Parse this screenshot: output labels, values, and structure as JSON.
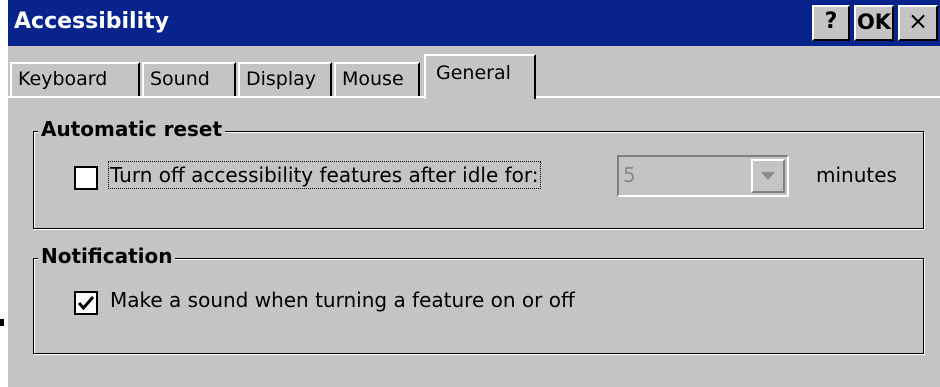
{
  "window": {
    "title": "Accessibility",
    "help_label": "?",
    "ok_label": "OK",
    "close_label": "×"
  },
  "tabs": [
    {
      "label": "Keyboard",
      "active": false
    },
    {
      "label": "Sound",
      "active": false
    },
    {
      "label": "Display",
      "active": false
    },
    {
      "label": "Mouse",
      "active": false
    },
    {
      "label": "General",
      "active": true
    }
  ],
  "automatic_reset": {
    "group_label": "Automatic reset",
    "checkbox_label": "Turn off accessibility features after idle for:",
    "checked": false,
    "idle_value": "5",
    "combo_enabled": false,
    "units_label": "minutes"
  },
  "notification": {
    "group_label": "Notification",
    "checkbox_label": "Make a sound when turning a feature on or off",
    "checked": true
  },
  "colors": {
    "titlebar": "#08248c",
    "face": "#c6c3c6",
    "disabled_text": "#8c8a8c"
  },
  "icons": {
    "check": "checkmark-icon",
    "dropdown": "chevron-down-icon"
  }
}
